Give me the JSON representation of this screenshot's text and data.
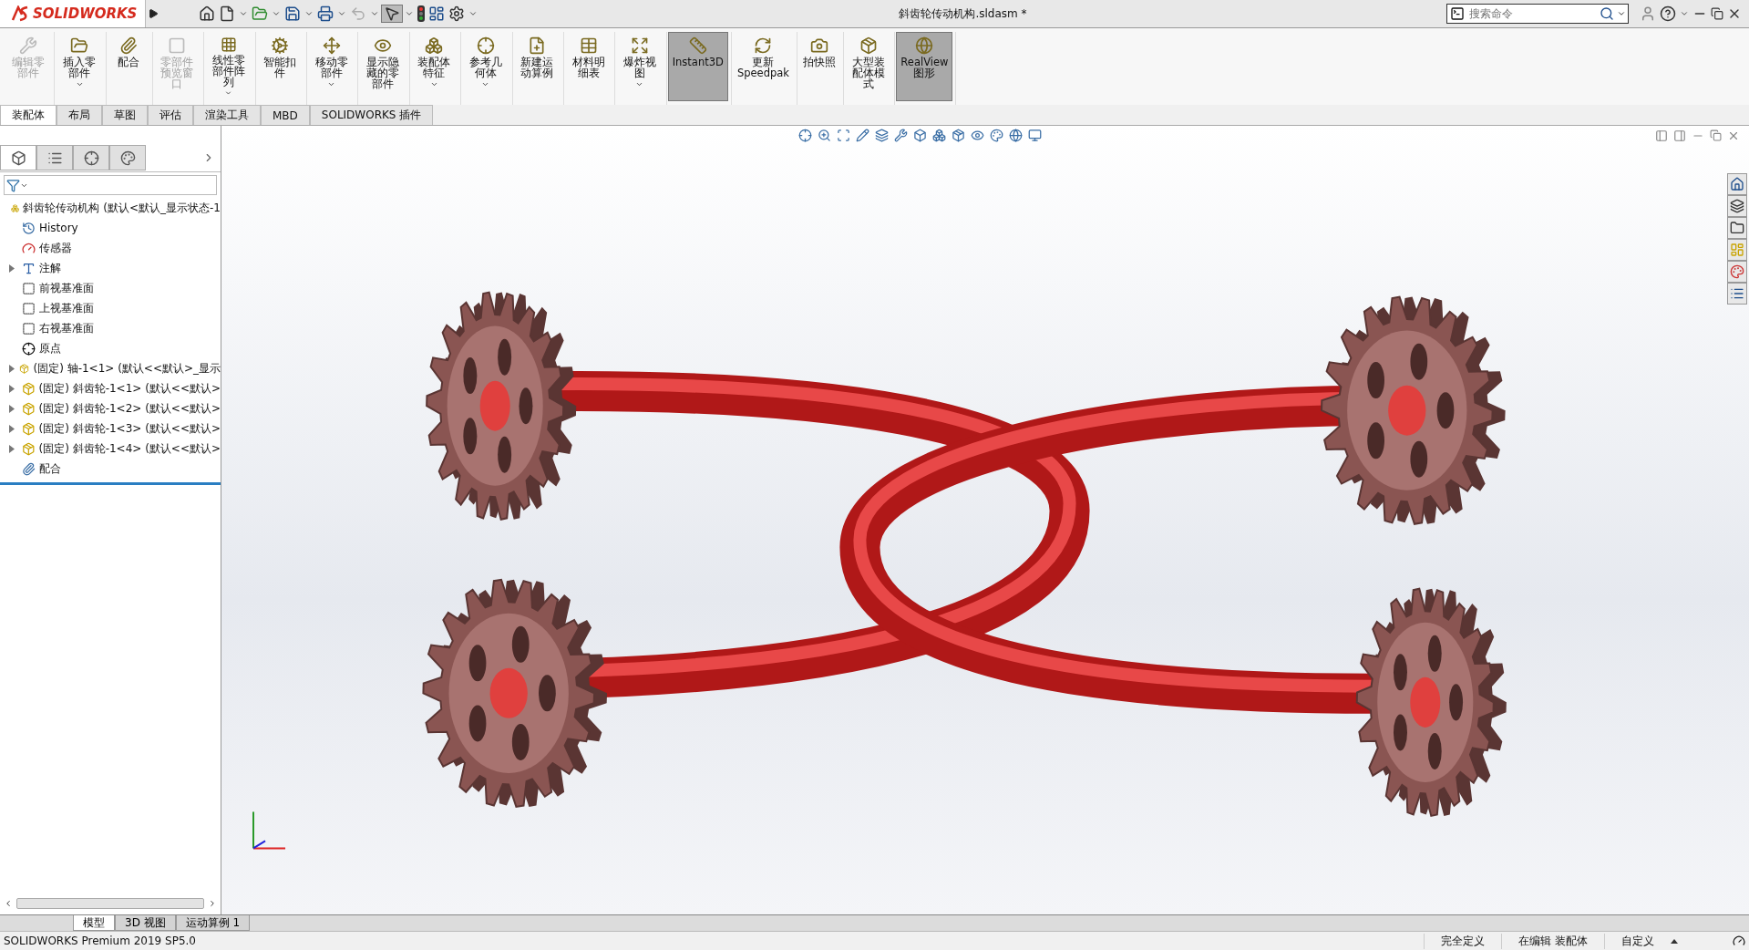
{
  "app": {
    "logo": "SOLIDWORKS",
    "title": "斜齿轮传动机构.sldasm *",
    "search": {
      "placeholder": "搜索命令"
    }
  },
  "ribbon": {
    "commands": [
      {
        "label": "编辑零部件",
        "disabled": true,
        "pressed": false,
        "dropdown": false
      },
      {
        "label": "插入零部件",
        "disabled": false,
        "pressed": false,
        "dropdown": true
      },
      {
        "label": "配合",
        "disabled": false,
        "pressed": false,
        "dropdown": false
      },
      {
        "label": "零部件预览窗口",
        "disabled": true,
        "pressed": false,
        "dropdown": false
      },
      {
        "label": "线性零部件阵列",
        "disabled": false,
        "pressed": false,
        "dropdown": true
      },
      {
        "label": "智能扣件",
        "disabled": false,
        "pressed": false,
        "dropdown": false
      },
      {
        "label": "移动零部件",
        "disabled": false,
        "pressed": false,
        "dropdown": true
      },
      {
        "label": "显示隐藏的零部件",
        "disabled": false,
        "pressed": false,
        "dropdown": false
      },
      {
        "label": "装配体特征",
        "disabled": false,
        "pressed": false,
        "dropdown": true
      },
      {
        "label": "参考几何体",
        "disabled": false,
        "pressed": false,
        "dropdown": true
      },
      {
        "label": "新建运动算例",
        "disabled": false,
        "pressed": false,
        "dropdown": false
      },
      {
        "label": "材料明细表",
        "disabled": false,
        "pressed": false,
        "dropdown": false
      },
      {
        "label": "爆炸视图",
        "disabled": false,
        "pressed": false,
        "dropdown": true
      },
      {
        "label": "Instant3D",
        "disabled": false,
        "pressed": true,
        "dropdown": false
      },
      {
        "label": "更新 Speedpak",
        "disabled": false,
        "pressed": false,
        "dropdown": false
      },
      {
        "label": "拍快照",
        "disabled": false,
        "pressed": false,
        "dropdown": false
      },
      {
        "label": "大型装配体模式",
        "disabled": false,
        "pressed": false,
        "dropdown": false
      },
      {
        "label": "RealView 图形",
        "disabled": false,
        "pressed": true,
        "dropdown": false
      }
    ],
    "tabs": [
      {
        "label": "装配体",
        "selected": true
      },
      {
        "label": "布局",
        "selected": false
      },
      {
        "label": "草图",
        "selected": false
      },
      {
        "label": "评估",
        "selected": false
      },
      {
        "label": "渲染工具",
        "selected": false
      },
      {
        "label": "MBD",
        "selected": false
      },
      {
        "label": "SOLIDWORKS 插件",
        "selected": false
      }
    ]
  },
  "feature_tree": {
    "panel_tabs": [
      {
        "selected": true
      },
      {
        "selected": false
      },
      {
        "selected": false
      },
      {
        "selected": false
      }
    ],
    "items": [
      {
        "kind": "assembly",
        "label": "斜齿轮传动机构 (默认<默认_显示状态-1",
        "collapsible": false
      },
      {
        "kind": "history",
        "label": "History",
        "collapsible": false
      },
      {
        "kind": "sensor",
        "label": "传感器",
        "collapsible": false
      },
      {
        "kind": "annotation",
        "label": "注解",
        "collapsible": true
      },
      {
        "kind": "plane",
        "label": "前视基准面",
        "collapsible": false
      },
      {
        "kind": "plane",
        "label": "上视基准面",
        "collapsible": false
      },
      {
        "kind": "plane",
        "label": "右视基准面",
        "collapsible": false
      },
      {
        "kind": "origin",
        "label": "原点",
        "collapsible": false
      },
      {
        "kind": "part",
        "label": "(固定) 轴-1<1> (默认<<默认>_显示",
        "collapsible": true
      },
      {
        "kind": "part",
        "label": "(固定) 斜齿轮-1<1> (默认<<默认>",
        "collapsible": true
      },
      {
        "kind": "part",
        "label": "(固定) 斜齿轮-1<2> (默认<<默认>",
        "collapsible": true
      },
      {
        "kind": "part",
        "label": "(固定) 斜齿轮-1<3> (默认<<默认>",
        "collapsible": true
      },
      {
        "kind": "part",
        "label": "(固定) 斜齿轮-1<4> (默认<<默认>",
        "collapsible": true
      },
      {
        "kind": "mate",
        "label": "配合",
        "collapsible": false
      }
    ]
  },
  "bottom_tabs": [
    {
      "label": "模型",
      "selected": true
    },
    {
      "label": "3D 视图",
      "selected": false
    },
    {
      "label": "运动算例 1",
      "selected": false
    }
  ],
  "status_bar": {
    "version": "SOLIDWORKS Premium 2019 SP5.0",
    "fields": [
      "完全定义",
      "在编辑 装配体",
      "自定义"
    ]
  }
}
